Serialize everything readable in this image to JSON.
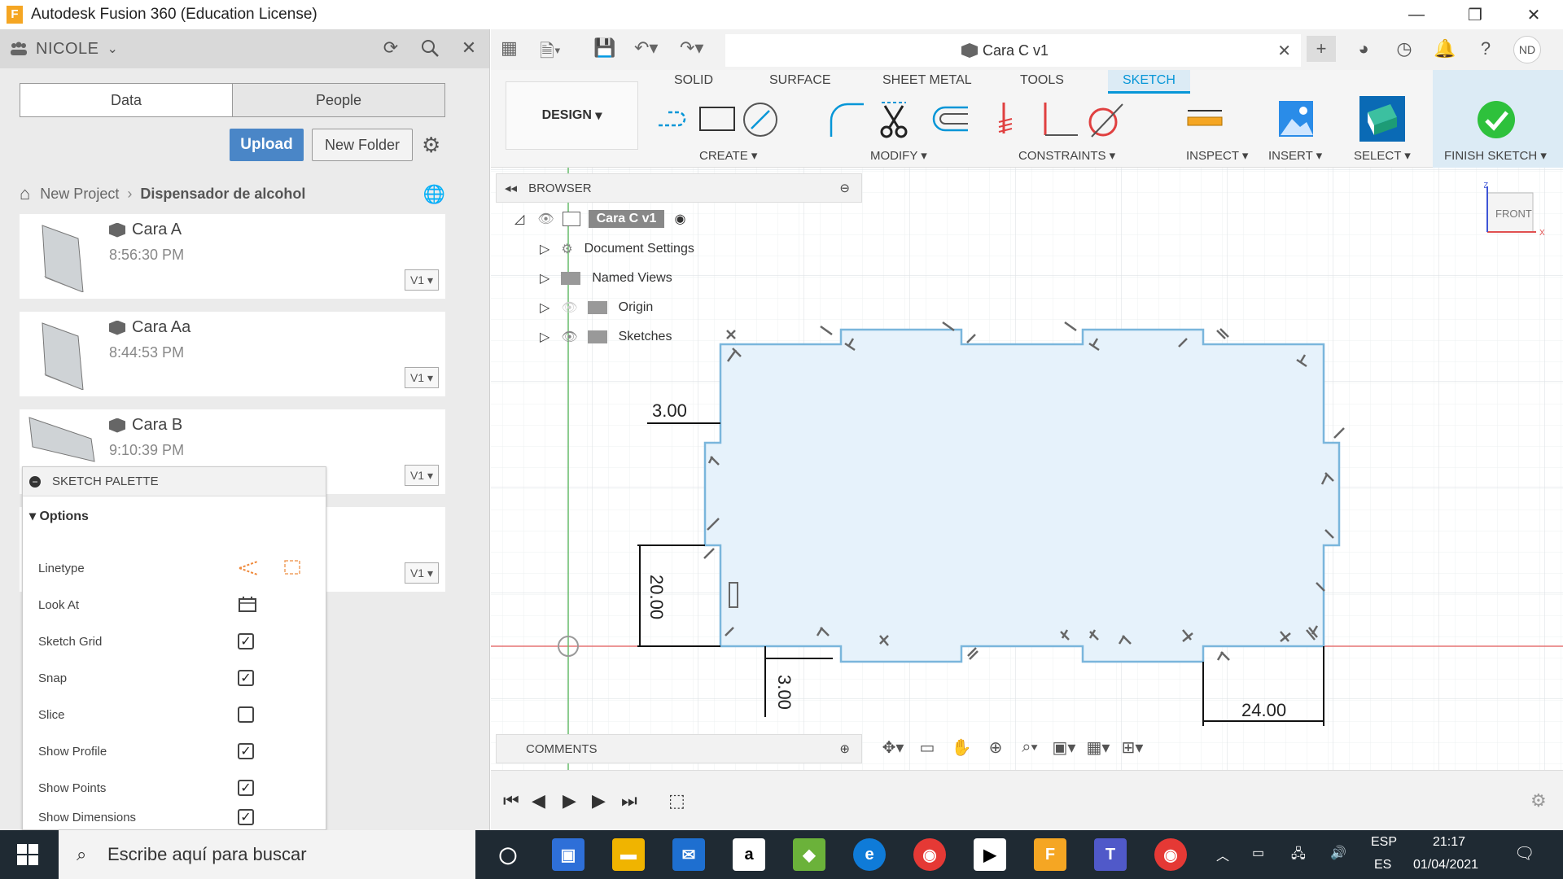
{
  "window": {
    "app_logo": "F",
    "title": "Autodesk Fusion 360 (Education License)",
    "minimize": "—",
    "restore": "❐",
    "close": "✕"
  },
  "data_panel": {
    "user": "NICOLE",
    "tabs": [
      "Data",
      "People"
    ],
    "upload_label": "Upload",
    "new_folder_label": "New Folder",
    "breadcrumb": [
      "New Project",
      "Dispensador de alcohol"
    ],
    "files": [
      {
        "name": "Cara A",
        "time": "8:56:30 PM",
        "version": "V1"
      },
      {
        "name": "Cara Aa",
        "time": "8:44:53 PM",
        "version": "V1"
      },
      {
        "name": "Cara B",
        "time": "9:10:39 PM",
        "version": "V1"
      },
      {
        "name": "",
        "time": "",
        "version": "V1"
      }
    ]
  },
  "sketch_palette": {
    "title": "SKETCH PALETTE",
    "section": "Options",
    "rows": [
      {
        "label": "Linetype",
        "type": "icons"
      },
      {
        "label": "Look At",
        "type": "icon"
      },
      {
        "label": "Sketch Grid",
        "checked": true
      },
      {
        "label": "Snap",
        "checked": true
      },
      {
        "label": "Slice",
        "checked": false
      },
      {
        "label": "Show Profile",
        "checked": true
      },
      {
        "label": "Show Points",
        "checked": true
      },
      {
        "label": "Show Dimensions",
        "checked": true
      }
    ]
  },
  "document_tab": {
    "name": "Cara C v1"
  },
  "user_avatar": "ND",
  "ribbon": {
    "workspace": "DESIGN",
    "tabs": [
      "SOLID",
      "SURFACE",
      "SHEET METAL",
      "TOOLS",
      "SKETCH"
    ],
    "active_tab": "SKETCH",
    "groups": [
      "CREATE",
      "MODIFY",
      "CONSTRAINTS",
      "INSPECT",
      "INSERT",
      "SELECT",
      "FINISH SKETCH"
    ]
  },
  "browser": {
    "title": "BROWSER",
    "root": "Cara C v1",
    "items": [
      "Document Settings",
      "Named Views",
      "Origin",
      "Sketches"
    ]
  },
  "viewcube": {
    "face": "FRONT",
    "axis_z": "Z",
    "axis_x": "X"
  },
  "dimensions": [
    "3.00",
    "20.00",
    "3.00",
    "24.00"
  ],
  "comments_label": "COMMENTS",
  "taskbar": {
    "search_placeholder": "Escribe aquí para buscar",
    "lang_top": "ESP",
    "lang_bottom": "ES",
    "time": "21:17",
    "date": "01/04/2021"
  },
  "colors": {
    "accent": "#0696d7",
    "upload_button": "#4a86c7",
    "profile_fill": "#e6f2fb",
    "profile_stroke": "#7ab6dc",
    "x_axis": "#e57373",
    "y_axis": "#66bb6a"
  }
}
